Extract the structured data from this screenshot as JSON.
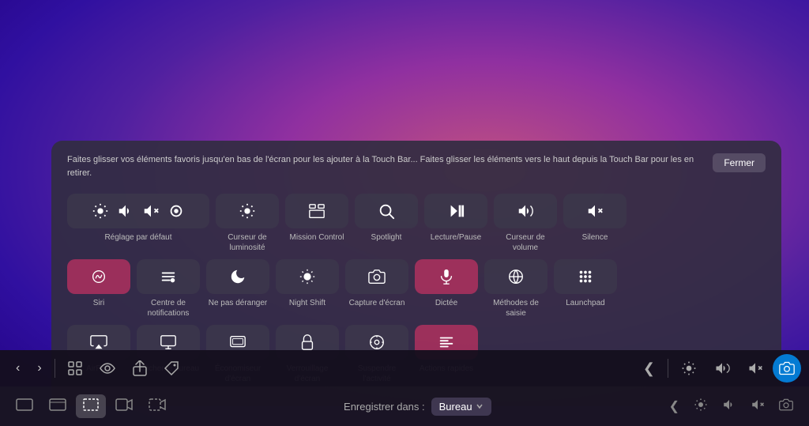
{
  "background": {
    "style": "radial-gradient purple-pink"
  },
  "modal": {
    "info_text": "Faites glisser vos éléments favoris jusqu'en bas de l'écran pour les ajouter à la Touch Bar... Faites glisser les éléments vers le haut depuis la Touch Bar pour les en retirer.",
    "close_label": "Fermer"
  },
  "rows": [
    {
      "id": "row1",
      "items": [
        {
          "id": "reglage",
          "label": "Réglage par défaut",
          "icon": "default",
          "wide": true
        },
        {
          "id": "curseur-lum",
          "label": "Curseur de\nluminosité",
          "icon": "brightness"
        },
        {
          "id": "mission-control",
          "label": "Mission Control",
          "icon": "mission"
        },
        {
          "id": "spotlight",
          "label": "Spotlight",
          "icon": "search"
        },
        {
          "id": "lecture-pause",
          "label": "Lecture/Pause",
          "icon": "play-pause"
        },
        {
          "id": "curseur-vol",
          "label": "Curseur de volume",
          "icon": "volume-slider"
        },
        {
          "id": "silence",
          "label": "Silence",
          "icon": "mute"
        }
      ]
    },
    {
      "id": "row2",
      "items": [
        {
          "id": "siri",
          "label": "Siri",
          "icon": "siri",
          "pink": true
        },
        {
          "id": "centre-notif",
          "label": "Centre de\nnotifications",
          "icon": "notifications"
        },
        {
          "id": "ne-pas-deranger",
          "label": "Ne pas déranger",
          "icon": "moon"
        },
        {
          "id": "night-shift",
          "label": "Night Shift",
          "icon": "night-shift"
        },
        {
          "id": "capture",
          "label": "Capture d'écran",
          "icon": "camera"
        },
        {
          "id": "dictee",
          "label": "Dictée",
          "icon": "mic"
        },
        {
          "id": "methodes",
          "label": "Méthodes de saisie",
          "icon": "globe"
        },
        {
          "id": "launchpad",
          "label": "Launchpad",
          "icon": "launchpad"
        }
      ]
    },
    {
      "id": "row3",
      "items": [
        {
          "id": "airplay",
          "label": "AirPlay",
          "icon": "airplay"
        },
        {
          "id": "afficher-bureau",
          "label": "Afficher le bureau",
          "icon": "desktop"
        },
        {
          "id": "economiseur",
          "label": "Économiseur d'écran",
          "icon": "screen-saver"
        },
        {
          "id": "verrouillage",
          "label": "Verrouillage d'écran",
          "icon": "lock-screen"
        },
        {
          "id": "suspendre",
          "label": "Suspendre l'activité",
          "icon": "sleep"
        },
        {
          "id": "actions-rapides",
          "label": "Actions rapides",
          "icon": "actions",
          "pink": true
        }
      ]
    }
  ],
  "touch_bar": {
    "nav": {
      "back": "‹",
      "forward": "›"
    },
    "controls": [
      {
        "id": "tb-grid",
        "icon": "⊞"
      },
      {
        "id": "tb-eye",
        "icon": "👁"
      },
      {
        "id": "tb-share",
        "icon": "↑□"
      },
      {
        "id": "tb-tag",
        "icon": "◇"
      }
    ],
    "right_controls": [
      {
        "id": "tb-angle",
        "icon": "❮"
      },
      {
        "id": "tb-brightness",
        "icon": "☀"
      },
      {
        "id": "tb-volume",
        "icon": "🔊"
      },
      {
        "id": "tb-mute",
        "icon": "🔇"
      },
      {
        "id": "tb-camera",
        "icon": "📷",
        "active": true
      }
    ]
  },
  "bottom_bar": {
    "left_buttons": [
      {
        "id": "bb-screen",
        "icon": "▭"
      },
      {
        "id": "bb-window",
        "icon": "⬜"
      },
      {
        "id": "bb-selection",
        "icon": "⬚",
        "active": true
      },
      {
        "id": "bb-video",
        "icon": "◫"
      },
      {
        "id": "bb-partial",
        "icon": "⬛"
      }
    ],
    "record_label": "Enregistrer dans :",
    "record_dest": "Bureau",
    "right_buttons": [
      {
        "id": "bb-angle",
        "icon": "❮"
      },
      {
        "id": "bb-brightness2",
        "icon": "☀"
      },
      {
        "id": "bb-volume2",
        "icon": "🔊"
      },
      {
        "id": "bb-mute2",
        "icon": "🔇"
      },
      {
        "id": "bb-cam2",
        "icon": "📷"
      }
    ]
  }
}
